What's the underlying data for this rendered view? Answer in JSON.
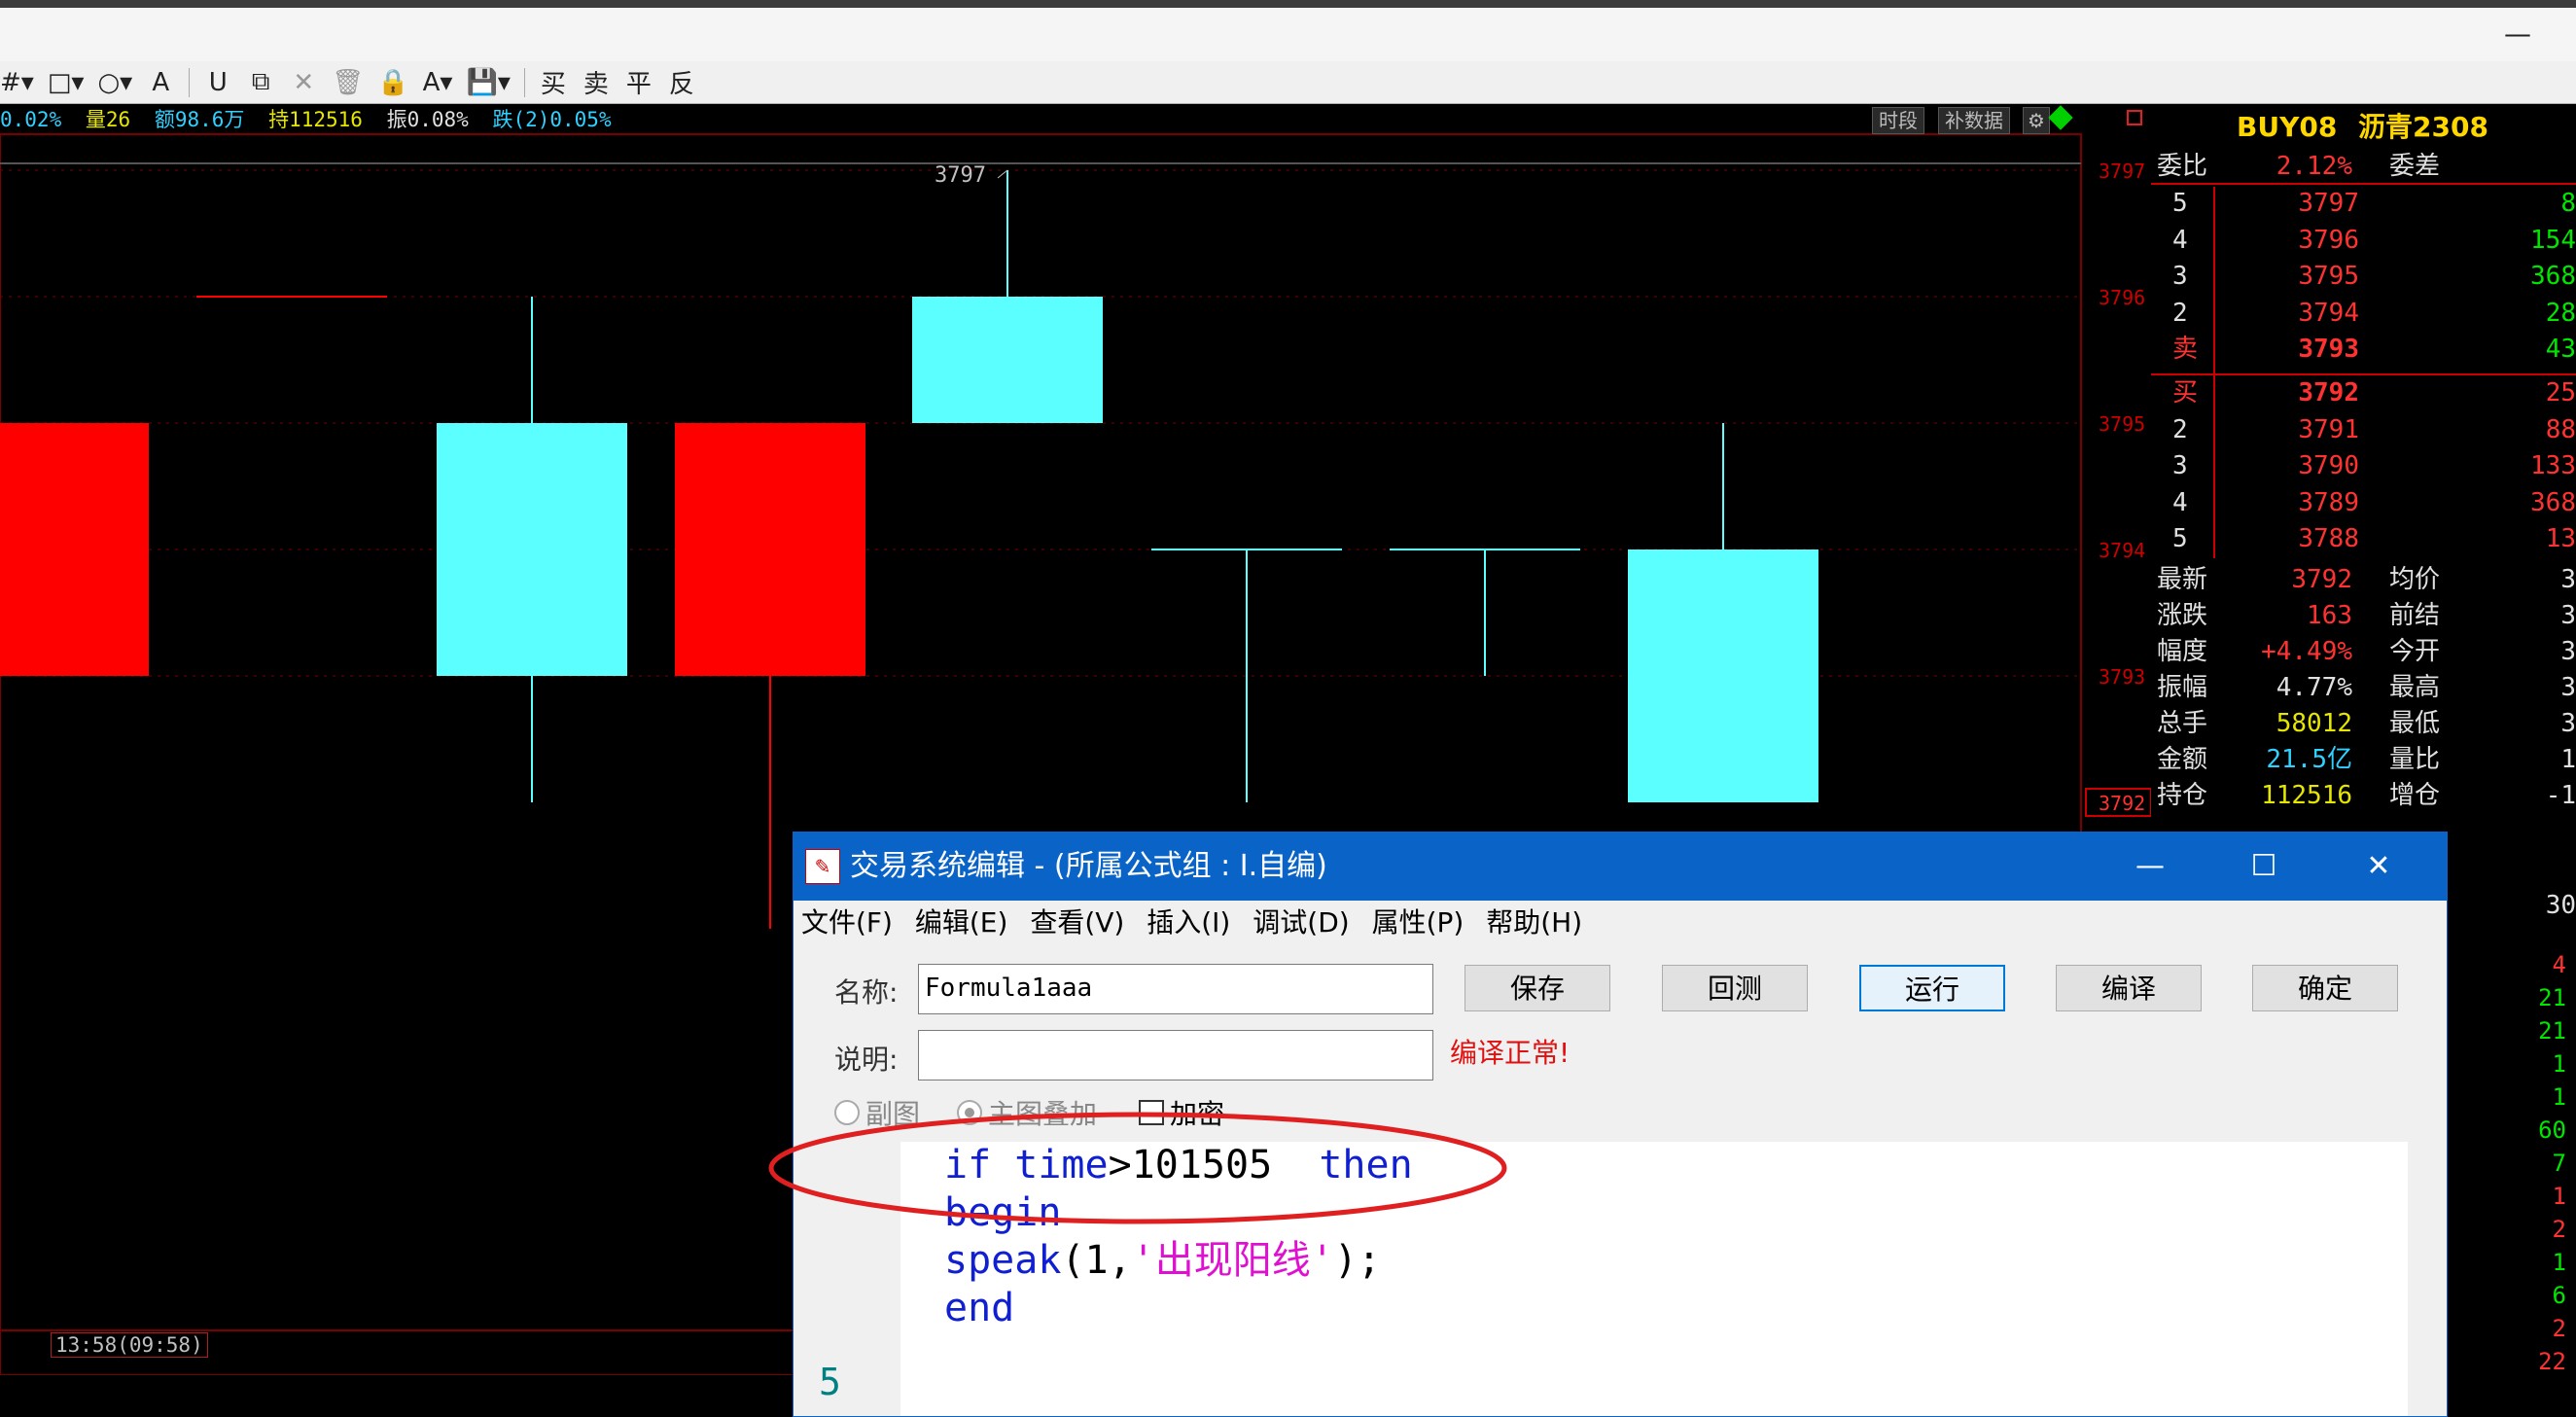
{
  "window": {
    "minimize_glyph": "—"
  },
  "toolbar": {
    "icons": [
      "grid-icon",
      "rectangle-icon",
      "circle-icon",
      "text-a-icon",
      "magnet-icon",
      "copy-icon",
      "delete-x-icon",
      "trash-icon",
      "lock-icon",
      "font-color-icon",
      "save-icon"
    ],
    "actions": [
      "买",
      "卖",
      "平",
      "反"
    ]
  },
  "infobar": {
    "pct": "0.02%",
    "volume": "量26",
    "amount": "额98.6万",
    "hold": "持112516",
    "amplitude": "振0.08%",
    "change": "跌(2)0.05%",
    "btn_period": "时段",
    "btn_fill": "补数据"
  },
  "chart_data": {
    "type": "candlestick",
    "y_ticks": [
      "3797",
      "3796",
      "3795",
      "3794",
      "3793"
    ],
    "current_price_label": "3792",
    "high_label": "3797",
    "candles": [
      {
        "open": 3795,
        "close": 3793,
        "high": 3795,
        "low": 3793,
        "color": "red"
      },
      {
        "open": 3796,
        "close": 3796,
        "high": 3796,
        "low": 3796,
        "color": "red-flat"
      },
      {
        "open": 3795,
        "close": 3793,
        "high": 3796,
        "low": 3792,
        "color": "cyan"
      },
      {
        "open": 3793,
        "close": 3795,
        "high": 3795,
        "low": 3791,
        "color": "red"
      },
      {
        "open": 3796,
        "close": 3795,
        "high": 3797,
        "low": 3795,
        "color": "cyan"
      },
      {
        "open": 3794,
        "close": 3794,
        "high": 3794,
        "low": 3792,
        "color": "cyan-flat"
      },
      {
        "open": 3794,
        "close": 3794,
        "high": 3794,
        "low": 3793,
        "color": "cyan-flat"
      },
      {
        "open": 3794,
        "close": 3792,
        "high": 3795,
        "low": 3792,
        "color": "cyan"
      }
    ],
    "bottom_time": "13:58(09:58)"
  },
  "quote": {
    "code": "BUY08",
    "name": "沥青2308",
    "weibi_label": "委比",
    "weibi_value": "2.12%",
    "weicha_label": "委差",
    "asks": [
      {
        "level": "5",
        "price": "3797",
        "vol": "8"
      },
      {
        "level": "4",
        "price": "3796",
        "vol": "154"
      },
      {
        "level": "3",
        "price": "3795",
        "vol": "368"
      },
      {
        "level": "2",
        "price": "3794",
        "vol": "28"
      },
      {
        "level": "卖",
        "price": "3793",
        "vol": "43"
      }
    ],
    "bids": [
      {
        "level": "买",
        "price": "3792",
        "vol": "25"
      },
      {
        "level": "2",
        "price": "3791",
        "vol": "88"
      },
      {
        "level": "3",
        "price": "3790",
        "vol": "133"
      },
      {
        "level": "4",
        "price": "3789",
        "vol": "368"
      },
      {
        "level": "5",
        "price": "3788",
        "vol": "13"
      }
    ],
    "stats": [
      {
        "l1": "最新",
        "v1": "3792",
        "l2": "均价",
        "v2": "3",
        "c1": "red"
      },
      {
        "l1": "涨跌",
        "v1": "163",
        "l2": "前结",
        "v2": "3",
        "c1": "red"
      },
      {
        "l1": "幅度",
        "v1": "+4.49%",
        "l2": "今开",
        "v2": "3",
        "c1": "red"
      },
      {
        "l1": "振幅",
        "v1": "4.77%",
        "l2": "最高",
        "v2": "3",
        "c1": "white"
      },
      {
        "l1": "总手",
        "v1": "58012",
        "l2": "最低",
        "v2": "3",
        "c1": "yellow"
      },
      {
        "l1": "金额",
        "v1": "21.5亿",
        "l2": "量比",
        "v2": "1",
        "c1": "cyan"
      },
      {
        "l1": "持仓",
        "v1": "112516",
        "l2": "增仓",
        "v2": "-1",
        "c1": "yellow"
      }
    ],
    "side_value": "30",
    "ticks": [
      {
        "v": "4",
        "c": "red"
      },
      {
        "v": "21",
        "c": "green"
      },
      {
        "v": "21",
        "c": "green"
      },
      {
        "v": "1",
        "c": "green"
      },
      {
        "v": "1",
        "c": "green"
      },
      {
        "v": "60",
        "c": "green"
      },
      {
        "v": "7",
        "c": "green"
      },
      {
        "v": "1",
        "c": "red"
      },
      {
        "v": "2",
        "c": "red"
      },
      {
        "v": "1",
        "c": "green"
      },
      {
        "v": "6",
        "c": "green"
      },
      {
        "v": "2",
        "c": "red"
      },
      {
        "v": "22",
        "c": "red"
      }
    ]
  },
  "dialog": {
    "title": "交易系统编辑 - (所属公式组 : I.自编)",
    "btn_min": "—",
    "btn_max": "☐",
    "btn_close": "✕",
    "menu": [
      "文件(F)",
      "编辑(E)",
      "查看(V)",
      "插入(I)",
      "调试(D)",
      "属性(P)",
      "帮助(H)"
    ],
    "name_label": "名称:",
    "name_value": "Formula1aaa",
    "desc_label": "说明:",
    "desc_value": "",
    "status": "编译正常!",
    "buttons": [
      "保存",
      "回测",
      "运行",
      "编译",
      "确定"
    ],
    "radio_sub": "副图",
    "radio_main": "主图叠加",
    "check_encrypt": "加密",
    "code_lines": [
      [
        {
          "t": "if time",
          "k": "kw"
        },
        {
          "t": ">101505  ",
          "k": "pl"
        },
        {
          "t": "then",
          "k": "kw"
        }
      ],
      [
        {
          "t": "begin",
          "k": "kw"
        }
      ],
      [
        {
          "t": "speak",
          "k": "kw"
        },
        {
          "t": "(1,",
          "k": "pl"
        },
        {
          "t": "'出现阳线'",
          "k": "str"
        },
        {
          "t": ");",
          "k": "pl"
        }
      ],
      [
        {
          "t": "end",
          "k": "kw"
        }
      ]
    ],
    "line_number": "5"
  },
  "colors": {
    "up": "#ff0000",
    "down": "#5cffff",
    "grid": "#7a0000",
    "accent": "#0a64c8",
    "annotation": "#e02020"
  }
}
